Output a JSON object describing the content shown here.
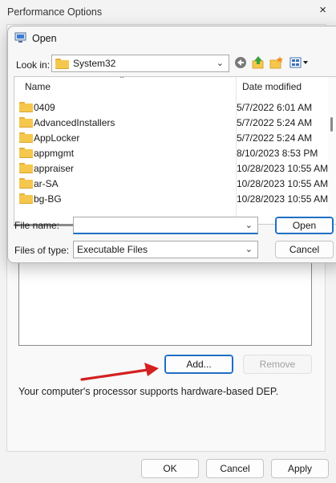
{
  "perf_window": {
    "title": "Performance Options",
    "close_glyph": "×",
    "add_label": "Add...",
    "remove_label": "Remove",
    "dep_text": "Your computer's processor supports hardware-based DEP.",
    "ok_label": "OK",
    "cancel_label": "Cancel",
    "apply_label": "Apply"
  },
  "open_dialog": {
    "title": "Open",
    "close_glyph": "×",
    "look_in_label": "Look in:",
    "look_in_value": "System32",
    "columns": {
      "name": "Name",
      "date": "Date modified"
    },
    "files": [
      {
        "name": "0409",
        "date": "5/7/2022 6:01 AM"
      },
      {
        "name": "AdvancedInstallers",
        "date": "5/7/2022 5:24 AM"
      },
      {
        "name": "AppLocker",
        "date": "5/7/2022 5:24 AM"
      },
      {
        "name": "appmgmt",
        "date": "8/10/2023 8:53 PM"
      },
      {
        "name": "appraiser",
        "date": "10/28/2023 10:55 AM"
      },
      {
        "name": "ar-SA",
        "date": "10/28/2023 10:55 AM"
      },
      {
        "name": "bg-BG",
        "date": "10/28/2023 10:55 AM"
      }
    ],
    "file_name_label": "File name:",
    "file_name_value": "",
    "files_of_type_label": "Files of type:",
    "files_of_type_value": "Executable Files",
    "open_label": "Open",
    "cancel_label": "Cancel"
  },
  "icons": {
    "back": "back-arrow-icon",
    "up": "up-folder-icon",
    "new_folder": "new-folder-icon",
    "view": "view-menu-icon",
    "folder": "folder-icon"
  },
  "colors": {
    "accent": "#1f6fc4",
    "folder": "#f5c74c",
    "arrow": "#d42020"
  }
}
